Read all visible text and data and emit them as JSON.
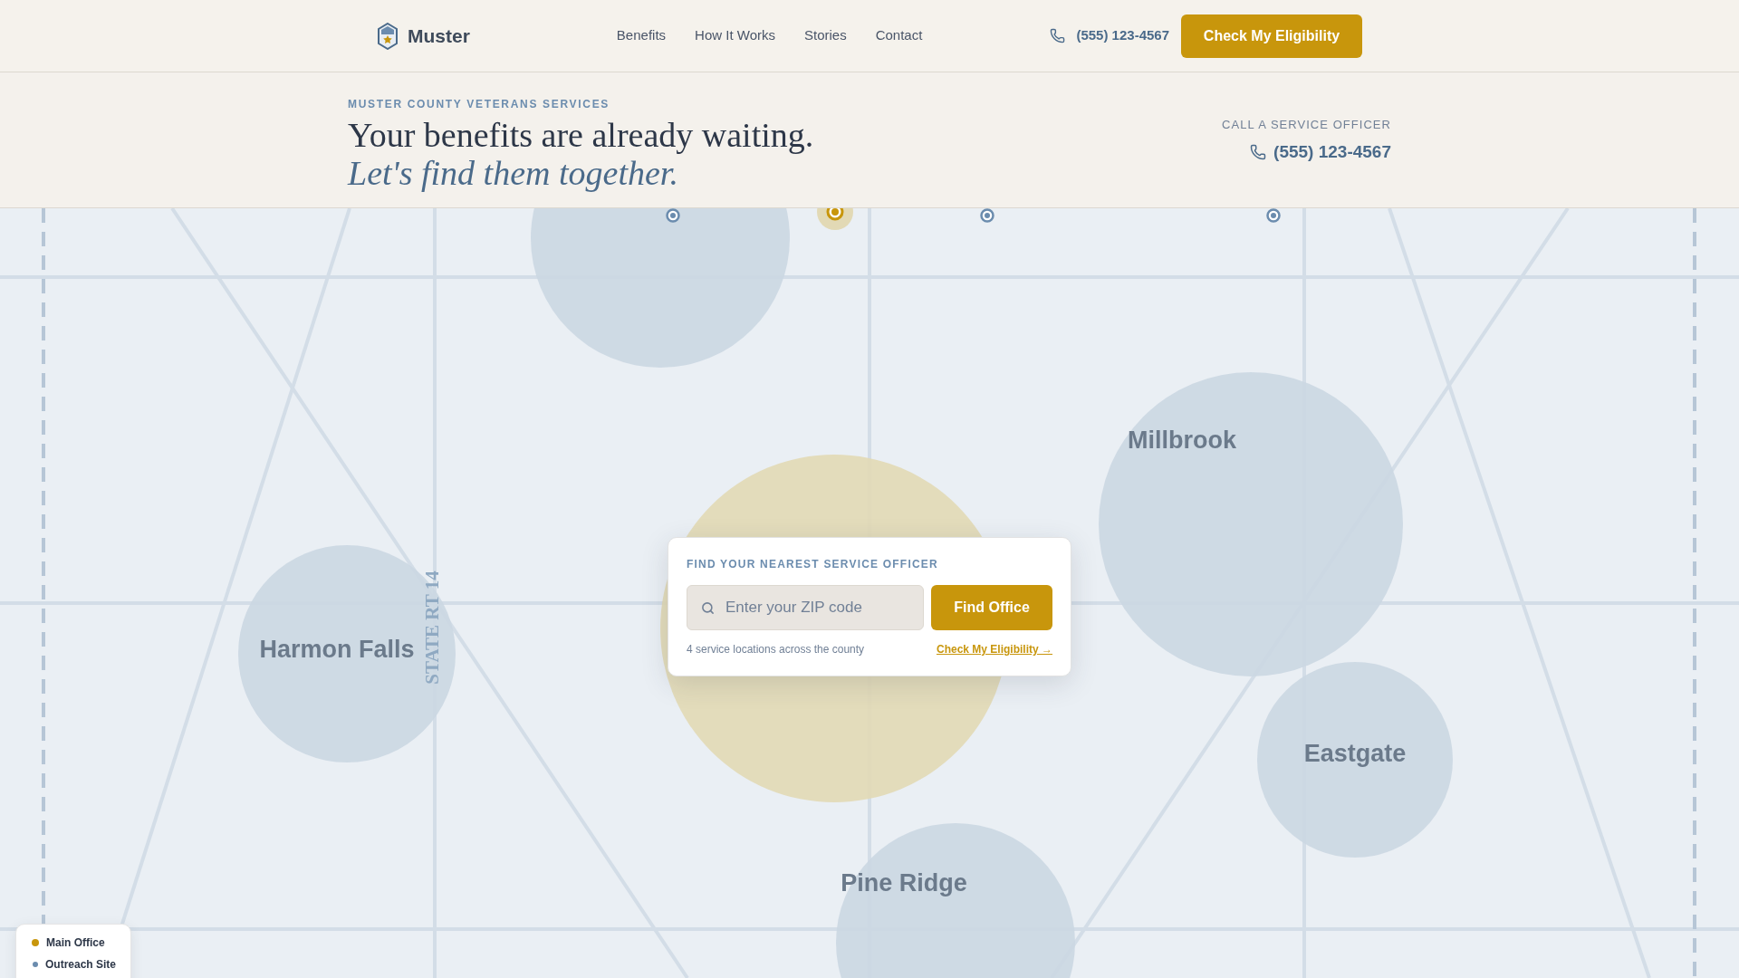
{
  "nav": {
    "logo": "Muster",
    "links": [
      "Benefits",
      "How It Works",
      "Stories",
      "Contact"
    ],
    "phone": "(555) 123-4567",
    "cta": "Check My Eligibility"
  },
  "hero": {
    "eyebrow": "MUSTER COUNTY VETERANS SERVICES",
    "headline": "Your benefits are already waiting.",
    "tagline": "Let's find them together.",
    "call_label": "CALL A SERVICE OFFICER",
    "call_phone": "(555) 123-4567"
  },
  "map": {
    "towns": [
      {
        "name": "Millbrook"
      },
      {
        "name": "Harmon Falls"
      },
      {
        "name": "Eastgate"
      },
      {
        "name": "Pine Ridge"
      }
    ],
    "route": "STATE RT 14",
    "search": {
      "title": "FIND YOUR NEAREST SERVICE OFFICER",
      "placeholder": "Enter your ZIP code",
      "button": "Find Office",
      "note": "4 service locations across the county",
      "link": "Check My Eligibility →"
    },
    "legend": [
      {
        "label": "Main Office",
        "color": "#c8960c"
      },
      {
        "label": "Outreach Site",
        "color": "#6b8cae"
      }
    ]
  }
}
